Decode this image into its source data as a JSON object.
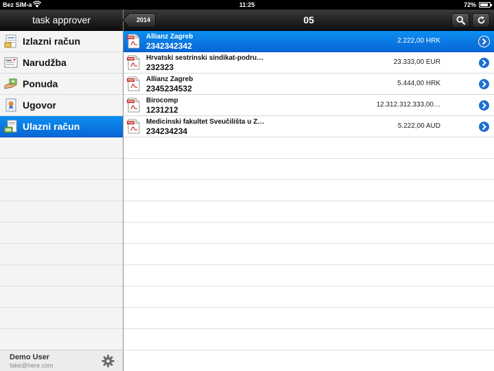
{
  "status_bar": {
    "carrier": "Bez SIM-a",
    "time": "11:25",
    "battery": "72%",
    "battery_level": 0.72
  },
  "sidebar": {
    "title": "task approver",
    "items": [
      {
        "label": "Izlazni račun",
        "icon": "outgoing-invoice-icon",
        "selected": false
      },
      {
        "label": "Narudžba",
        "icon": "order-icon",
        "selected": false
      },
      {
        "label": "Ponuda",
        "icon": "offer-icon",
        "selected": false
      },
      {
        "label": "Ugovor",
        "icon": "contract-icon",
        "selected": false
      },
      {
        "label": "Ulazni račun",
        "icon": "incoming-invoice-icon",
        "selected": true
      }
    ],
    "footer": {
      "user_name": "Demo User",
      "user_email": "fake@here.com"
    }
  },
  "main": {
    "back_label": "2014",
    "title": "05",
    "rows": [
      {
        "name": "Allianz Zagreb",
        "number": "2342342342",
        "amount": "2.222,00 HRK",
        "selected": true
      },
      {
        "name": "Hrvatski sestrinski sindikat-podru…",
        "number": "232323",
        "amount": "23.333,00 EUR",
        "selected": false
      },
      {
        "name": "Allianz Zagreb",
        "number": "2345234532",
        "amount": "5.444,00 HRK",
        "selected": false
      },
      {
        "name": "Birocomp",
        "number": "1231212",
        "amount": "12.312.312.333,00…",
        "selected": false
      },
      {
        "name": "Medicinski fakultet Sveučilišta u Z…",
        "number": "234234234",
        "amount": "5.222,00 AUD",
        "selected": false
      }
    ]
  },
  "colors": {
    "selection": "#0a7ae6",
    "header": "#1e1e1e",
    "disclosure": "#1e6fd0"
  }
}
